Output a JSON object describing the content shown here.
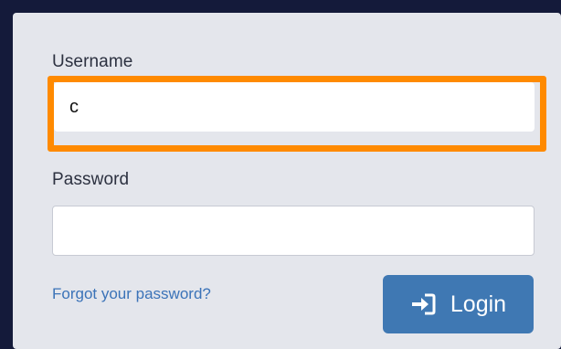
{
  "form": {
    "username": {
      "label": "Username",
      "value": "c"
    },
    "password": {
      "label": "Password",
      "value": ""
    },
    "forgot_link": "Forgot your password?",
    "login_button": {
      "label": "Login",
      "icon": "sign-in-icon"
    }
  },
  "colors": {
    "background": "#141a3a",
    "panel": "#e4e6ec",
    "focus_highlight": "#ff8a00",
    "link": "#3b73b8",
    "button": "#3f78b3"
  }
}
